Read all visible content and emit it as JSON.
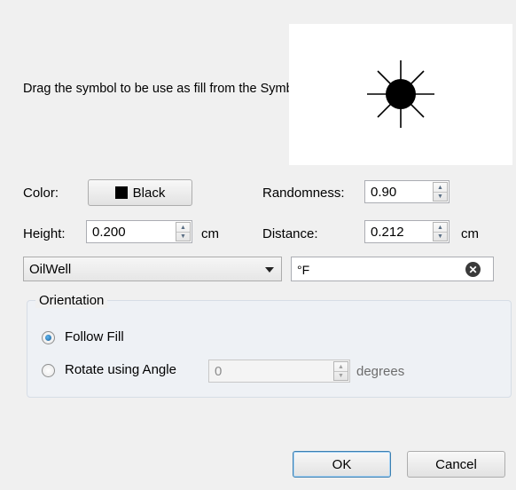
{
  "instructions": "Drag the symbol to be use as fill from the Symbols bar to this dialog.",
  "color": {
    "label": "Color:",
    "value": "Black",
    "swatch": "#000000"
  },
  "randomness": {
    "label": "Randomness:",
    "value": "0.90"
  },
  "height": {
    "label": "Height:",
    "value": "0.200",
    "unit": "cm"
  },
  "distance": {
    "label": "Distance:",
    "value": "0.212",
    "unit": "cm"
  },
  "symbol_select": {
    "value": "OilWell"
  },
  "symbol_text": {
    "value": "°F"
  },
  "orientation": {
    "title": "Orientation",
    "follow_fill": "Follow Fill",
    "rotate": "Rotate using Angle",
    "angle_value": "0",
    "angle_unit": "degrees",
    "selected": "follow_fill"
  },
  "buttons": {
    "ok": "OK",
    "cancel": "Cancel"
  },
  "icons": {
    "preview": "oilwell-symbol-icon",
    "clear": "clear-icon"
  }
}
